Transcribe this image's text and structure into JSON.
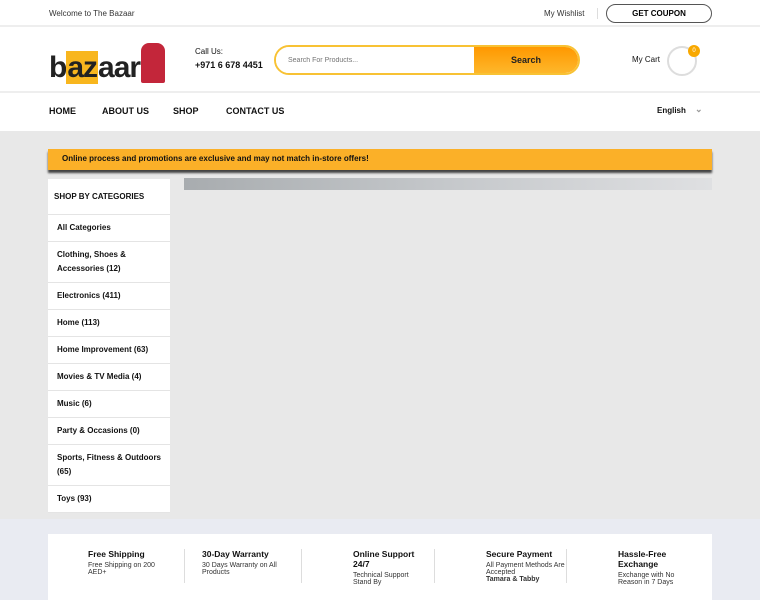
{
  "topbar": {
    "welcome": "Welcome to The Bazaar",
    "wishlist": "My Wishlist",
    "coupon": "GET COUPON"
  },
  "header": {
    "logo": "bazaar",
    "call_label": "Call Us:",
    "phone": "+971 6 678 4451",
    "search_placeholder": "Search For Products...",
    "search_button": "Search",
    "cart_label": "My Cart",
    "cart_count": "0"
  },
  "nav": {
    "items": [
      "HOME",
      "ABOUT US",
      "SHOP",
      "CONTACT US"
    ],
    "language": "English"
  },
  "promo": "Online process and promotions are exclusive and may not match in-store offers!",
  "sidebar": {
    "title": "SHOP BY CATEGORIES",
    "items": [
      "All Categories",
      "Clothing, Shoes & Accessories (12)",
      "Electronics (411)",
      "Home (113)",
      "Home Improvement (63)",
      "Movies & TV Media (4)",
      "Music (6)",
      "Party & Occasions (0)",
      "Sports, Fitness & Outdoors (65)",
      "Toys (93)"
    ]
  },
  "features": [
    {
      "title": "Free Shipping",
      "text": "Free Shipping on 200 AED+"
    },
    {
      "title": "30-Day Warranty",
      "text": "30 Days Warranty on All Products"
    },
    {
      "title": "Online Support 24/7",
      "text": "Technical Support Stand By"
    },
    {
      "title": "Secure Payment",
      "text": "All Payment Methods Are Accepted",
      "bold": "Tamara & Tabby"
    },
    {
      "title": "Hassle-Free Exchange",
      "text": "Exchange with No Reason in 7 Days"
    }
  ]
}
